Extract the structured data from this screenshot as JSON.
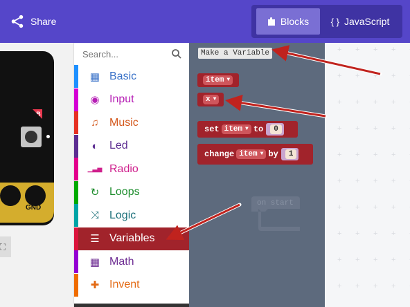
{
  "header": {
    "share_label": "Share",
    "tabs": [
      {
        "label": "Blocks",
        "icon": "puzzle-icon",
        "icon_glyph": "▆",
        "active": true
      },
      {
        "label": "JavaScript",
        "icon": "braces-icon",
        "icon_glyph": "{ }",
        "active": false
      }
    ]
  },
  "simulator": {
    "button_label": "B",
    "pin_label": "GND",
    "fullscreen_glyph": "⛶"
  },
  "toolbox": {
    "search_placeholder": "Search...",
    "categories": [
      {
        "label": "Basic",
        "icon": "grid-icon",
        "glyph": "▦",
        "color": "#1e90ff",
        "text_color": "#3a72c8",
        "selected": false
      },
      {
        "label": "Input",
        "icon": "target-icon",
        "glyph": "◉",
        "color": "#d400d4",
        "text_color": "#b61fb5",
        "selected": false
      },
      {
        "label": "Music",
        "icon": "headphones-icon",
        "glyph": "♫",
        "color": "#e63022",
        "text_color": "#d3561a",
        "selected": false
      },
      {
        "label": "Led",
        "icon": "toggle-icon",
        "glyph": "◐",
        "color": "#5c2d91",
        "text_color": "#5c2d91",
        "selected": false
      },
      {
        "label": "Radio",
        "icon": "signal-icon",
        "glyph": "▁▃▅",
        "color": "#e3008c",
        "text_color": "#cf1f8c",
        "selected": false
      },
      {
        "label": "Loops",
        "icon": "refresh-icon",
        "glyph": "↻",
        "color": "#00aa00",
        "text_color": "#1b8c2b",
        "selected": false
      },
      {
        "label": "Logic",
        "icon": "shuffle-icon",
        "glyph": "⤨",
        "color": "#00a4a6",
        "text_color": "#1b6f7a",
        "selected": false
      },
      {
        "label": "Variables",
        "icon": "list-icon",
        "glyph": "☰",
        "color": "#dc143c",
        "text_color": "#ffffff",
        "selected": true
      },
      {
        "label": "Math",
        "icon": "calculator-icon",
        "glyph": "▦",
        "color": "#9400d3",
        "text_color": "#6d2c92",
        "selected": false
      },
      {
        "label": "Invent",
        "icon": "puzzle-icon",
        "glyph": "✚",
        "color": "#ef6c00",
        "text_color": "#e36a14",
        "selected": false
      }
    ],
    "selected_bg": "#a1232b"
  },
  "flyout": {
    "make_variable_label": "Make a Variable",
    "var_item": "item",
    "var_x": "x",
    "set_block": {
      "prefix": "set",
      "var": "item",
      "mid": "to",
      "value": "0"
    },
    "change_block": {
      "prefix": "change",
      "var": "item",
      "mid": "by",
      "value": "1"
    }
  },
  "workspace": {
    "ghost_label": "on start"
  },
  "colors": {
    "header": "#5546c9",
    "variables_block": "#a1232b",
    "annotation_arrow": "#c0231e"
  }
}
